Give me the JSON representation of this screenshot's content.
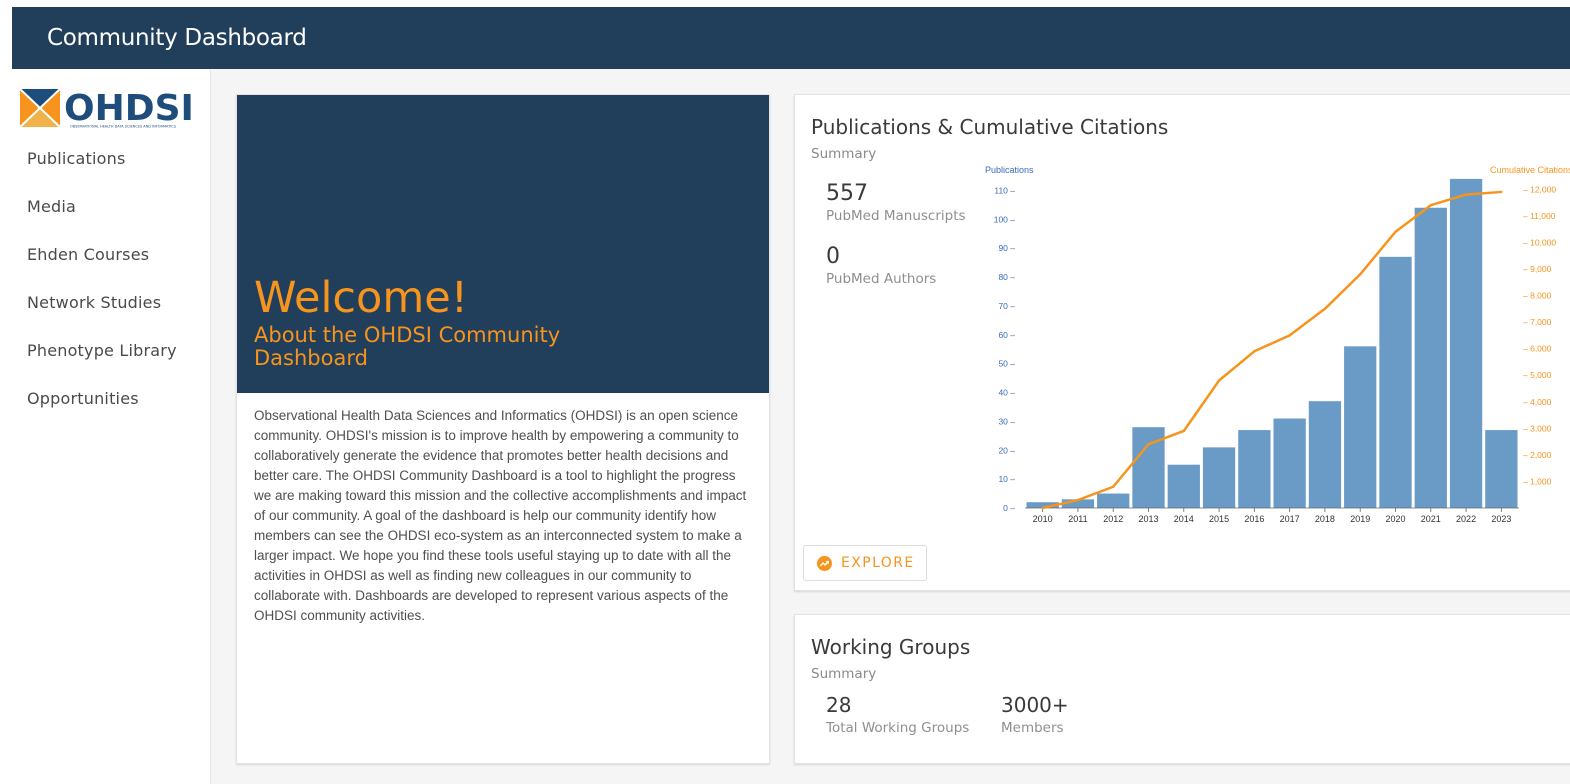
{
  "header": {
    "title": "Community Dashboard"
  },
  "sidebar": {
    "logo_text": "OHDSI",
    "logo_tagline": "OBSERVATIONAL HEALTH DATA SCIENCES AND INFORMATICS",
    "items": [
      {
        "label": "Publications"
      },
      {
        "label": "Media"
      },
      {
        "label": "Ehden Courses"
      },
      {
        "label": "Network Studies"
      },
      {
        "label": "Phenotype Library"
      },
      {
        "label": "Opportunities"
      }
    ]
  },
  "welcome": {
    "title": "Welcome!",
    "subtitle": "About the OHDSI Community Dashboard",
    "body": "Observational Health Data Sciences and Informatics (OHDSI) is an open science community. OHDSI's mission is to improve health by empowering a community to collaboratively generate the evidence that promotes better health decisions and better care. The OHDSI Community Dashboard is a tool to highlight the progress we are making toward this mission and the collective accomplishments and impact of our community. A goal of the dashboard is help our community identify how members can see the OHDSI eco-system as an interconnected system to make a larger impact. We hope you find these tools useful staying up to date with all the activities in OHDSI as well as finding new colleagues in our community to collaborate with. Dashboards are developed to represent various aspects of the OHDSI community activities."
  },
  "publications": {
    "title": "Publications & Cumulative Citations",
    "summary_label": "Summary",
    "stats": [
      {
        "value": "557",
        "label": "PubMed Manuscripts"
      },
      {
        "value": "0",
        "label": "PubMed Authors"
      }
    ],
    "explore_label": "EXPLORE"
  },
  "working_groups": {
    "title": "Working Groups",
    "summary_label": "Summary",
    "stats": [
      {
        "value": "28",
        "label": "Total Working Groups"
      },
      {
        "value": "3000+",
        "label": "Members"
      }
    ]
  },
  "colors": {
    "header_bg": "#213f5a",
    "accent": "#f7941d",
    "bar": "#6a9bc6",
    "left_axis": "#3a6db5"
  },
  "icons": {
    "explore": "trending-up-icon"
  },
  "chart_data": {
    "type": "bar",
    "ylabel": "Publications",
    "y2label": "Cumulative Citations",
    "ylim": [
      0,
      115
    ],
    "y2lim": [
      0,
      12500
    ],
    "yticks": [
      0,
      10,
      20,
      30,
      40,
      50,
      60,
      70,
      80,
      90,
      100,
      110
    ],
    "y2ticks": [
      1000,
      2000,
      3000,
      4000,
      5000,
      6000,
      7000,
      8000,
      9000,
      10000,
      11000,
      12000
    ],
    "categories": [
      "2010",
      "2011",
      "2012",
      "2013",
      "2014",
      "2015",
      "2016",
      "2017",
      "2018",
      "2019",
      "2020",
      "2021",
      "2022",
      "2023"
    ],
    "series": [
      {
        "name": "Publications",
        "type": "bar",
        "axis": "left",
        "values": [
          2,
          3,
          5,
          28,
          15,
          21,
          27,
          31,
          37,
          56,
          87,
          104,
          114,
          27
        ]
      },
      {
        "name": "Cumulative Citations",
        "type": "line",
        "axis": "right",
        "values": [
          0,
          300,
          800,
          2400,
          2900,
          4800,
          5900,
          6500,
          7500,
          8800,
          10400,
          11400,
          11800,
          11900
        ]
      }
    ],
    "grid": false
  }
}
